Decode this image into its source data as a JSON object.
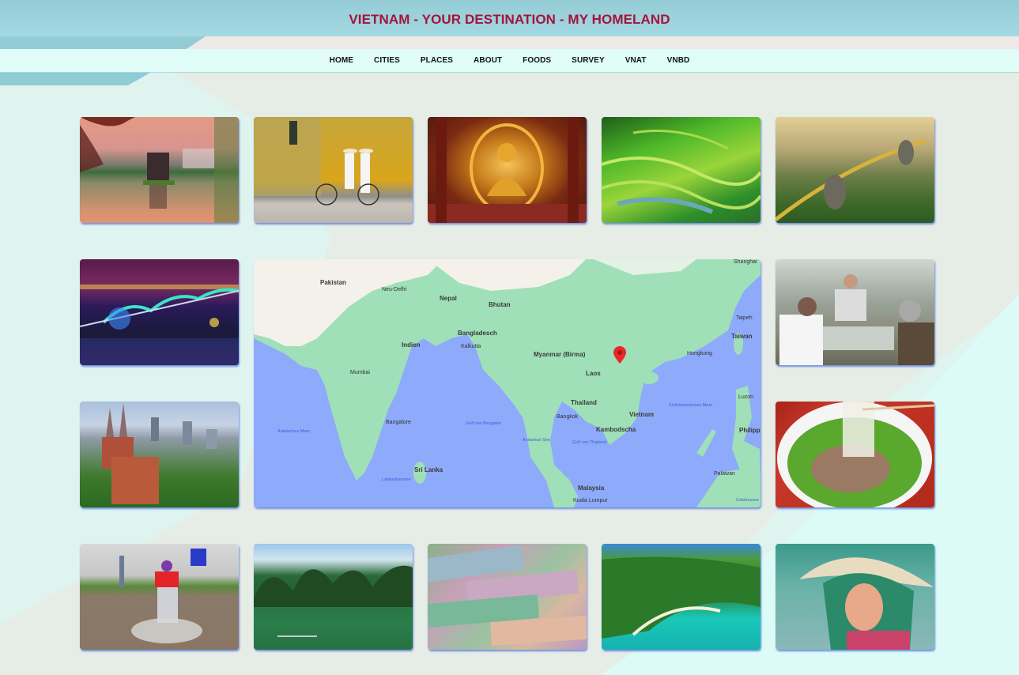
{
  "header": {
    "title": "VIETNAM - YOUR DESTINATION - MY HOMELAND"
  },
  "nav": {
    "items": [
      {
        "label": "HOME"
      },
      {
        "label": "CITIES"
      },
      {
        "label": "PLACES"
      },
      {
        "label": "ABOUT"
      },
      {
        "label": "FOODS"
      },
      {
        "label": "SURVEY"
      },
      {
        "label": "VNAT"
      },
      {
        "label": "VNBD"
      }
    ]
  },
  "colors": {
    "title": "#a5133a",
    "header_bg": "#9fd3de",
    "nav_bg": "#dffcf6",
    "tile_shadow": "#466edc",
    "map_water": "#8eaafb",
    "map_land": "#9fe0b8",
    "map_pin": "#e8262b"
  },
  "gallery": {
    "tiles": [
      {
        "subject": "Hoan Kiem Lake turtle tower at sunset",
        "icon": "photo-lake-pagoda"
      },
      {
        "subject": "Two women in ao dai riding bicycle by yellow wall",
        "icon": "photo-ao-dai-bicycle"
      },
      {
        "subject": "Golden Buddha statue in temple",
        "icon": "photo-golden-buddha"
      },
      {
        "subject": "Green rice terraces",
        "icon": "photo-rice-terraces"
      },
      {
        "subject": "Golden bridge held by stone hands",
        "icon": "photo-golden-bridge"
      },
      {
        "subject": "Dragon bridge lit at night",
        "icon": "photo-dragon-bridge"
      },
      {
        "subject": "Diners eating at street restaurant",
        "icon": "photo-street-dining"
      },
      {
        "subject": "Notre-Dame cathedral in city",
        "icon": "photo-cathedral"
      },
      {
        "subject": "Bowl of pho noodles",
        "icon": "photo-pho-bowl"
      },
      {
        "subject": "Motorbike on flooded street",
        "icon": "photo-flooded-street"
      },
      {
        "subject": "Ha Long Bay limestone islands",
        "icon": "photo-halong-bay"
      },
      {
        "subject": "Vietnamese dong banknotes",
        "icon": "photo-banknotes"
      },
      {
        "subject": "Tropical island beach",
        "icon": "photo-island-beach"
      },
      {
        "subject": "Woman wearing conical hat",
        "icon": "photo-conical-hat-woman"
      }
    ]
  },
  "map": {
    "pin_icon": "map-pin-icon",
    "labels": [
      {
        "text": "Pakistan",
        "type": "country"
      },
      {
        "text": "Neu-Delhi",
        "type": "city"
      },
      {
        "text": "Nepal",
        "type": "country"
      },
      {
        "text": "Bhutan",
        "type": "country"
      },
      {
        "text": "Indien",
        "type": "country"
      },
      {
        "text": "Bangladesch",
        "type": "country"
      },
      {
        "text": "Kalkutta",
        "type": "city"
      },
      {
        "text": "Mumbai",
        "type": "city"
      },
      {
        "text": "Myanmar (Birma)",
        "type": "country"
      },
      {
        "text": "Laos",
        "type": "country"
      },
      {
        "text": "Hongkong",
        "type": "city"
      },
      {
        "text": "Taipeh",
        "type": "city"
      },
      {
        "text": "Taiwan",
        "type": "country"
      },
      {
        "text": "Shanghai",
        "type": "city"
      },
      {
        "text": "Thailand",
        "type": "country"
      },
      {
        "text": "Bangkok",
        "type": "city"
      },
      {
        "text": "Vietnam",
        "type": "country"
      },
      {
        "text": "Kambodscha",
        "type": "country"
      },
      {
        "text": "Malaysia",
        "type": "country"
      },
      {
        "text": "Kuala Lumpur",
        "type": "city"
      },
      {
        "text": "Bangalore",
        "type": "city"
      },
      {
        "text": "Sri Lanka",
        "type": "country"
      },
      {
        "text": "Arabisches Meer",
        "type": "sea"
      },
      {
        "text": "Golf von Bengalen",
        "type": "sea"
      },
      {
        "text": "Andaman-See",
        "type": "sea"
      },
      {
        "text": "Golf von Thailand",
        "type": "sea"
      },
      {
        "text": "Südchinesisches Meer",
        "type": "sea"
      },
      {
        "text": "Lakkadivensee",
        "type": "sea"
      },
      {
        "text": "Philippi",
        "type": "country"
      },
      {
        "text": "Luzon",
        "type": "city"
      },
      {
        "text": "Palawan",
        "type": "city"
      },
      {
        "text": "Celebessee",
        "type": "sea"
      }
    ]
  }
}
